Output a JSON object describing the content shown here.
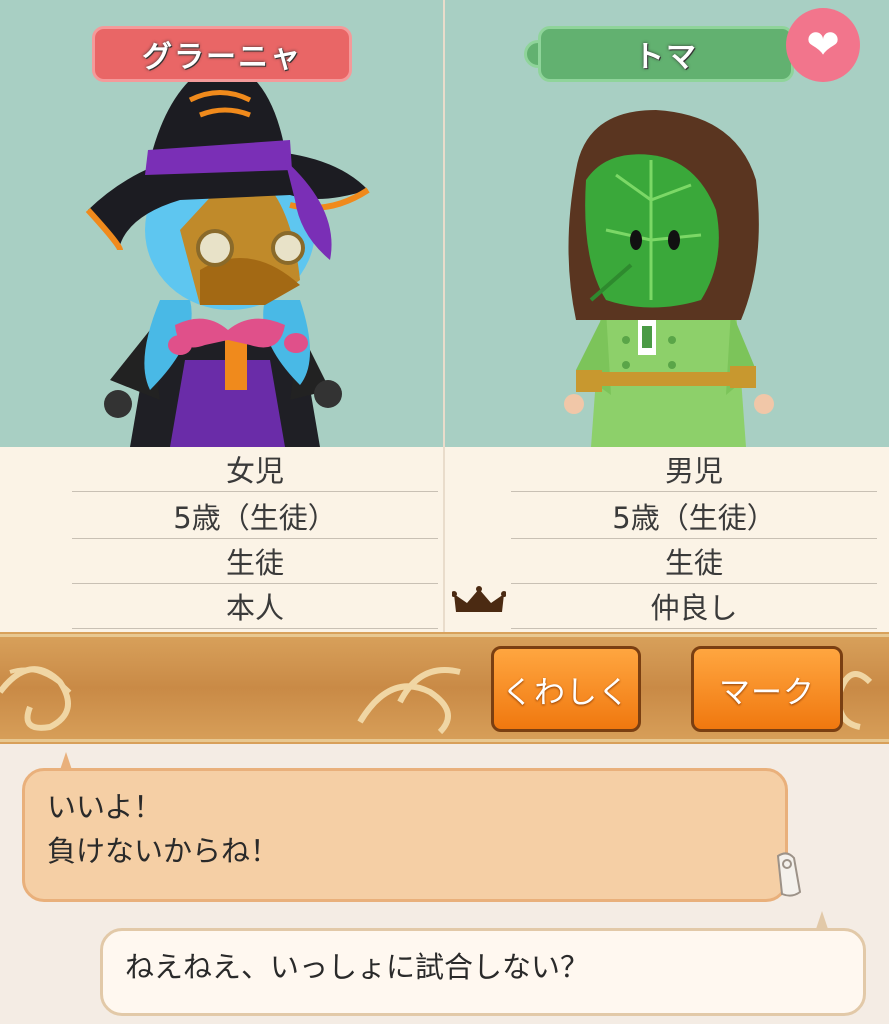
{
  "characters": [
    {
      "name": "グラーニャ",
      "gender": "女児",
      "age": "5歳（生徒）",
      "role": "生徒",
      "relation": "本人"
    },
    {
      "name": "トマ",
      "gender": "男児",
      "age": "5歳（生徒）",
      "role": "生徒",
      "relation": "仲良し"
    }
  ],
  "buttons": {
    "detail": "くわしく",
    "mark": "マーク"
  },
  "chat": [
    {
      "line1": "いいよ！",
      "line2": "負けないからね！"
    },
    {
      "line1": "ねえねえ、いっしょに試合しない？"
    }
  ],
  "icons": {
    "favorite": "heart-icon",
    "best_friend": "crown-icon",
    "clip": "clip-icon"
  },
  "colors": {
    "left_name_bg": "#e96666",
    "right_name_bg": "#62b170",
    "button_orange": "#f0780f",
    "heart_pink": "#f2758c"
  }
}
